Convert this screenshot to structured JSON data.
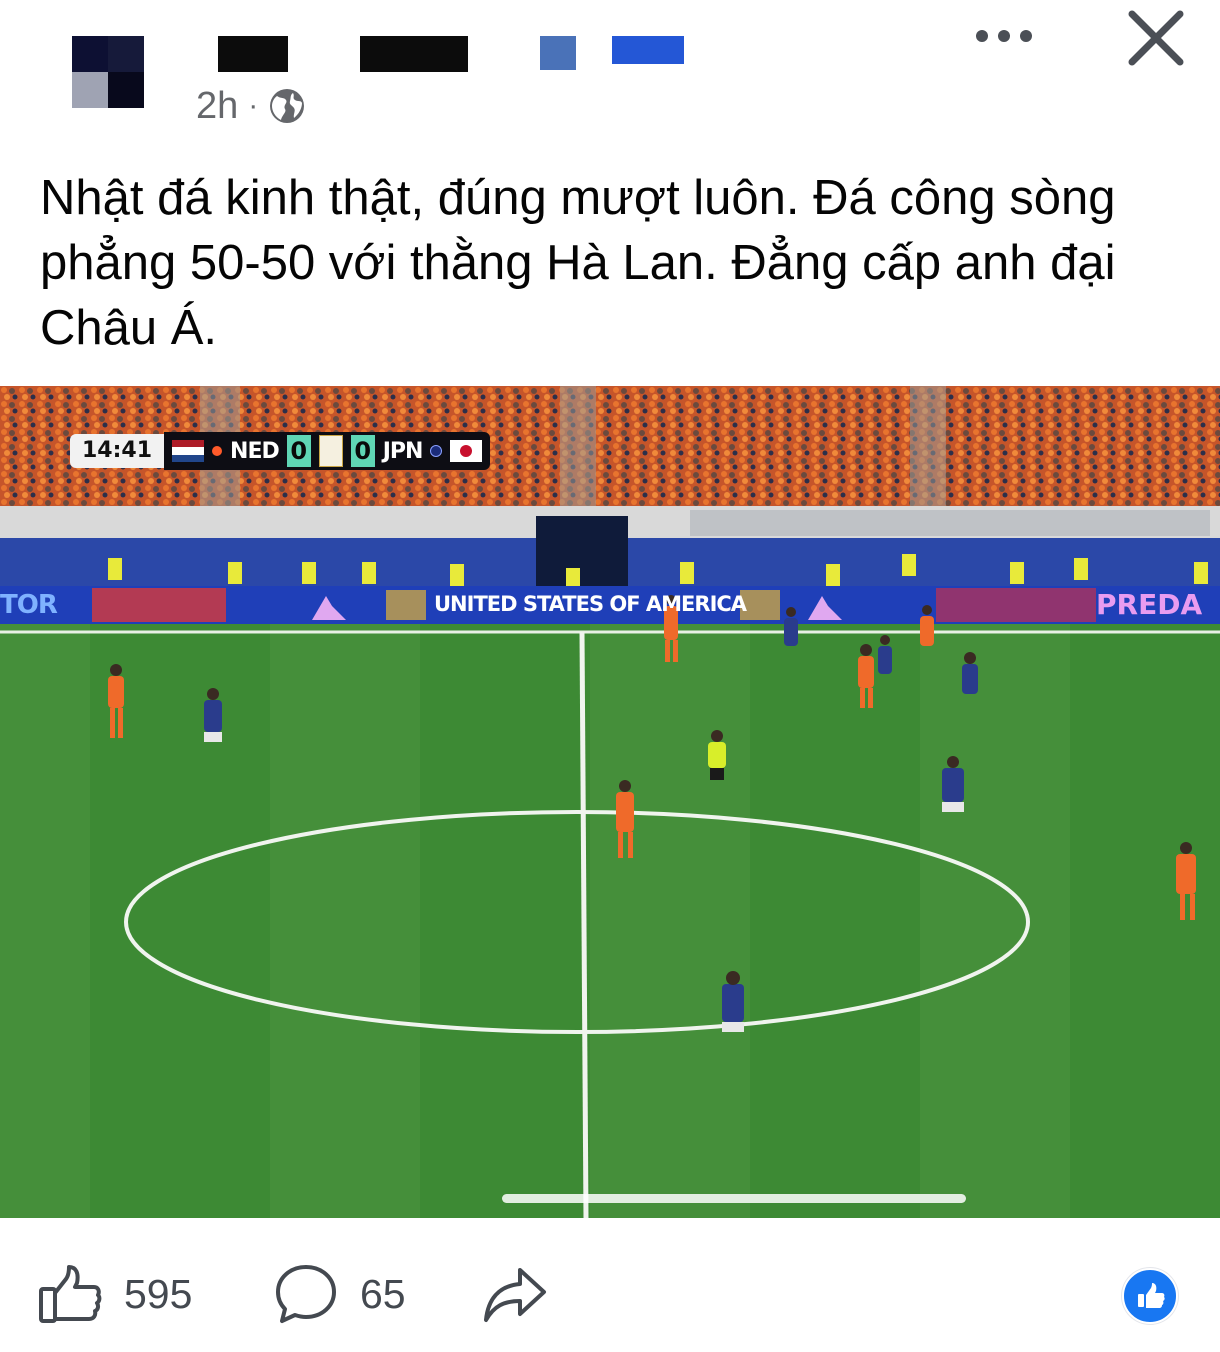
{
  "post": {
    "timestamp": "2h",
    "separator": "·",
    "privacy_icon": "globe-icon",
    "text": "Nhật đá kinh thật, đúng mượt luôn. Đá công sòng phẳng 50-50 với thằng Hà Lan. Đẳng cấp anh đại Châu Á."
  },
  "header": {
    "more_icon": "more-horizontal-icon",
    "close_icon": "close-icon"
  },
  "image": {
    "scoreboard": {
      "clock": "14:41",
      "home_team": "NED",
      "home_score": "0",
      "away_score": "0",
      "away_team": "JPN"
    },
    "board_center": "UNITED STATES OF AMERICA",
    "board_left": "TOR",
    "board_right": "PREDA"
  },
  "actions": {
    "likes": "595",
    "comments": "65",
    "like_icon": "thumbs-up-icon",
    "comment_icon": "comment-icon",
    "share_icon": "share-icon",
    "reaction_icon": "like-reaction-icon"
  },
  "colors": {
    "facebook_blue": "#1877f2",
    "text_primary": "#050505",
    "text_secondary": "#65676b",
    "pitch_green": "#3d8a34"
  }
}
